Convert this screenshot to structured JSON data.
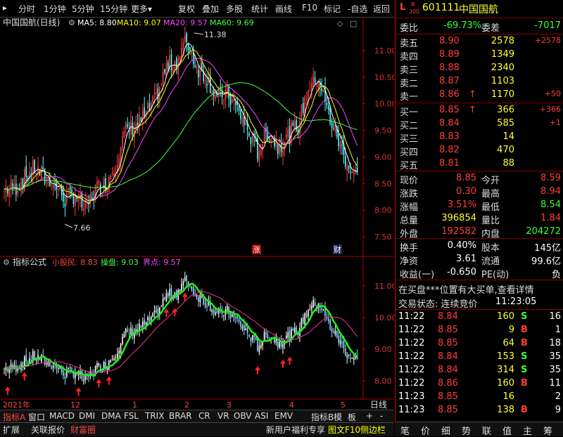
{
  "toolbar": {
    "left_items": [
      "分时",
      "1分钟",
      "5分钟",
      "15分钟",
      "更多"
    ],
    "right_items": [
      "复权",
      "叠加",
      "多股",
      "统计",
      "画线",
      "F10",
      "标记",
      "-自选",
      "返回"
    ]
  },
  "main_chart": {
    "title": "中国国航(日线)",
    "ma5": "MA5: 8.80",
    "ma10": "MA10: 9.07",
    "ma20": "MA20: 9.57",
    "ma60": "MA60: 9.69",
    "high_label": "11.38",
    "low_label": "7.66",
    "y_ticks": [
      "11.00",
      "10.50",
      "10.00",
      "9.50",
      "9.00",
      "8.50",
      "8.00",
      "7.50"
    ],
    "marker_zhang": "涨",
    "marker_cai": "财",
    "colors": {
      "ma5": "#ffffff",
      "ma10": "#ffff00",
      "ma20": "#ff44ff",
      "ma60": "#44ff44"
    }
  },
  "indicator_chart": {
    "title": "指标公式",
    "l1": "小股民: 8.83",
    "l2": "操盘: 9.03",
    "l3": "界点: 9.57",
    "y_ticks": [
      "11.00",
      "10.00",
      "9.00",
      "8.00"
    ]
  },
  "x_axis": {
    "labels": [
      "2021年",
      "12",
      "1",
      "2",
      "3",
      "4",
      "5"
    ],
    "period": "日线"
  },
  "quote": {
    "prefix": "L",
    "r_badge": "R",
    "r_num": "300",
    "code": "601111",
    "name": "中国国航",
    "weibi_label": "委比",
    "weibi": "-69.73%",
    "weicha_label": "委差",
    "weicha": "-7017",
    "asks": [
      {
        "label": "卖五",
        "price": "8.90",
        "vol": "2578",
        "chg": "+2578",
        "arrow": ""
      },
      {
        "label": "卖四",
        "price": "8.89",
        "vol": "1349",
        "chg": "",
        "arrow": ""
      },
      {
        "label": "卖三",
        "price": "8.88",
        "vol": "2340",
        "chg": "",
        "arrow": ""
      },
      {
        "label": "卖二",
        "price": "8.87",
        "vol": "1103",
        "chg": "",
        "arrow": ""
      },
      {
        "label": "卖一",
        "price": "8.86",
        "vol": "1170",
        "chg": "+50",
        "arrow": "↑"
      }
    ],
    "bids": [
      {
        "label": "买一",
        "price": "8.85",
        "vol": "366",
        "chg": "+366",
        "arrow": "↑"
      },
      {
        "label": "买二",
        "price": "8.84",
        "vol": "585",
        "chg": "+1",
        "arrow": ""
      },
      {
        "label": "买三",
        "price": "8.83",
        "vol": "14",
        "chg": "",
        "arrow": ""
      },
      {
        "label": "买四",
        "price": "8.82",
        "vol": "470",
        "chg": "",
        "arrow": ""
      },
      {
        "label": "买五",
        "price": "8.81",
        "vol": "88",
        "chg": "",
        "arrow": ""
      }
    ],
    "stats": [
      {
        "l1": "现价",
        "v1": "8.85",
        "c1": "red",
        "l2": "今开",
        "v2": "8.59",
        "c2": "red"
      },
      {
        "l1": "涨跌",
        "v1": "0.30",
        "c1": "red",
        "l2": "最高",
        "v2": "8.94",
        "c2": "red"
      },
      {
        "l1": "涨幅",
        "v1": "3.51%",
        "c1": "red",
        "l2": "最低",
        "v2": "8.54",
        "c2": "green"
      },
      {
        "l1": "总量",
        "v1": "396854",
        "c1": "yellow",
        "l2": "量比",
        "v2": "1.84",
        "c2": "red"
      },
      {
        "l1": "外盘",
        "v1": "192582",
        "c1": "red",
        "l2": "内盘",
        "v2": "204272",
        "c2": "green"
      }
    ],
    "stats2": [
      {
        "l1": "换手",
        "v1": "0.40%",
        "l2": "股本",
        "v2": "145亿"
      },
      {
        "l1": "净资",
        "v1": "3.61",
        "l2": "流通",
        "v2": "99.6亿"
      },
      {
        "l1": "收益(一)",
        "v1": "-0.650",
        "l2": "PE(动)",
        "v2": "负"
      }
    ],
    "notice": "在买盘***位置有大买单,查看详情",
    "status_label": "交易状态: 连续竞价",
    "status_time": "11:23:05",
    "ticks": [
      {
        "t": "11:22",
        "p": "8.84",
        "v": "160",
        "s": "S",
        "n": "16"
      },
      {
        "t": "11:22",
        "p": "8.85",
        "v": "9",
        "s": "B",
        "n": "1"
      },
      {
        "t": "11:22",
        "p": "8.85",
        "v": "64",
        "s": "B",
        "n": "18"
      },
      {
        "t": "11:22",
        "p": "8.84",
        "v": "153",
        "s": "S",
        "n": "35"
      },
      {
        "t": "11:22",
        "p": "8.84",
        "v": "314",
        "s": "S",
        "n": "35"
      },
      {
        "t": "11:22",
        "p": "8.86",
        "v": "160",
        "s": "B",
        "n": "11"
      },
      {
        "t": "11:23",
        "p": "8.85",
        "v": "16",
        "s": "",
        "n": "2"
      },
      {
        "t": "11:23",
        "p": "8.85",
        "v": "138",
        "s": "B",
        "n": "9"
      }
    ]
  },
  "tabs_row1": [
    "指标A",
    "窗口",
    "MACD",
    "DMI",
    "DMA",
    "FSL",
    "TRIX",
    "BRAR",
    "CR",
    "VR",
    "OBV",
    "ASI",
    "EMV"
  ],
  "tabs_row1_right": [
    "指标B",
    "模",
    "板",
    "+",
    "-"
  ],
  "tabs_row2": [
    "扩展",
    "关联报价",
    "财富圈"
  ],
  "tabs_row2_right": "新用户福利专享",
  "tabs_row2_right2": "图文F10",
  "tabs_row2_right3": "侧边栏",
  "sidebar_bottom": [
    "笔",
    "价",
    "细",
    "势",
    "联",
    "值",
    "主",
    "筹"
  ]
}
